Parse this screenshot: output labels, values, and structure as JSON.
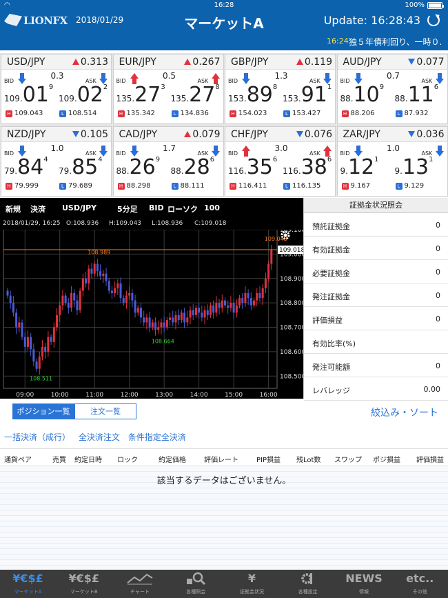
{
  "status": {
    "time": "16:28",
    "battery": "100%"
  },
  "header": {
    "logo": "LIONFX",
    "date": "2018/01/29",
    "title": "マーケットA",
    "update": "Update: 16:28:43"
  },
  "ticker": {
    "time": "16:24",
    "text": "独５年債利回り、一時０."
  },
  "labels": {
    "bid": "BID",
    "ask": "ASK",
    "high": "H",
    "low": "L"
  },
  "rates": [
    {
      "pair": "USD/JPY",
      "dir": "up",
      "change": "0.313",
      "spread": "0.3",
      "bid_arrow": "down",
      "ask_arrow": "down",
      "bid_pre": "109.",
      "bid_big": "01",
      "bid_pip": "9",
      "ask_pre": "109.",
      "ask_big": "02",
      "ask_pip": "2",
      "high": "109.043",
      "low": "108.514"
    },
    {
      "pair": "EUR/JPY",
      "dir": "up",
      "change": "0.267",
      "spread": "0.5",
      "bid_arrow": "up",
      "ask_arrow": "up",
      "bid_pre": "135.",
      "bid_big": "27",
      "bid_pip": "3",
      "ask_pre": "135.",
      "ask_big": "27",
      "ask_pip": "8",
      "high": "135.342",
      "low": "134.836"
    },
    {
      "pair": "GBP/JPY",
      "dir": "up",
      "change": "0.119",
      "spread": "1.3",
      "bid_arrow": "down",
      "ask_arrow": "down",
      "bid_pre": "153.",
      "bid_big": "89",
      "bid_pip": "8",
      "ask_pre": "153.",
      "ask_big": "91",
      "ask_pip": "1",
      "high": "154.023",
      "low": "153.427"
    },
    {
      "pair": "AUD/JPY",
      "dir": "down",
      "change": "0.077",
      "spread": "0.7",
      "bid_arrow": "down",
      "ask_arrow": "down",
      "bid_pre": "88.",
      "bid_big": "10",
      "bid_pip": "9",
      "ask_pre": "88.",
      "ask_big": "11",
      "ask_pip": "6",
      "high": "88.206",
      "low": "87.932"
    },
    {
      "pair": "NZD/JPY",
      "dir": "down",
      "change": "0.105",
      "spread": "1.0",
      "bid_arrow": "down",
      "ask_arrow": "down",
      "bid_pre": "79.",
      "bid_big": "84",
      "bid_pip": "4",
      "ask_pre": "79.",
      "ask_big": "85",
      "ask_pip": "4",
      "high": "79.999",
      "low": "79.689"
    },
    {
      "pair": "CAD/JPY",
      "dir": "up",
      "change": "0.079",
      "spread": "1.7",
      "bid_arrow": "down",
      "ask_arrow": "down",
      "bid_pre": "88.",
      "bid_big": "26",
      "bid_pip": "9",
      "ask_pre": "88.",
      "ask_big": "28",
      "ask_pip": "6",
      "high": "88.298",
      "low": "88.111"
    },
    {
      "pair": "CHF/JPY",
      "dir": "down",
      "change": "0.076",
      "spread": "3.0",
      "bid_arrow": "up",
      "ask_arrow": "up",
      "bid_pre": "116.",
      "bid_big": "35",
      "bid_pip": "6",
      "ask_pre": "116.",
      "ask_big": "38",
      "ask_pip": "6",
      "high": "116.411",
      "low": "116.135"
    },
    {
      "pair": "ZAR/JPY",
      "dir": "down",
      "change": "0.036",
      "spread": "1.0",
      "bid_arrow": "down",
      "ask_arrow": "down",
      "bid_pre": "9.",
      "bid_big": "12",
      "bid_pip": "1",
      "ask_pre": "9.",
      "ask_big": "13",
      "ask_pip": "1",
      "high": "9.167",
      "low": "9.129"
    }
  ],
  "chart_toolbar": {
    "new": "新規",
    "settle": "決済",
    "pair": "USD/JPY",
    "timeframe": "5分足",
    "side": "BID",
    "style": "ローソク",
    "count": "100"
  },
  "chart_info": {
    "datetime": "2018/01/29, 16:25",
    "open": "O:108.936",
    "high": "H:109.043",
    "low": "L:108.936",
    "close": "C:109.018"
  },
  "chart_data": {
    "type": "candlestick",
    "y_ticks": [
      "109.100",
      "109.000",
      "108.900",
      "108.800",
      "108.700",
      "108.600",
      "108.500"
    ],
    "ylim": [
      108.45,
      109.1
    ],
    "x_ticks": [
      "09:00",
      "10:00",
      "11:00",
      "12:00",
      "13:00",
      "14:00",
      "15:00",
      "16:00"
    ],
    "current_price": "109.018",
    "annotations": [
      {
        "label": "109.043",
        "index": 91,
        "value": 109.043,
        "color": "#ff7a1a"
      },
      {
        "label": "108.989",
        "index": 30,
        "value": 108.989,
        "color": "#ff7a1a"
      },
      {
        "label": "108.664",
        "index": 52,
        "value": 108.664,
        "color": "#35d135"
      },
      {
        "label": "108.511",
        "index": 10,
        "value": 108.511,
        "color": "#35d135"
      }
    ],
    "closes": [
      108.83,
      108.8,
      108.76,
      108.7,
      108.72,
      108.66,
      108.62,
      108.66,
      108.61,
      108.56,
      108.53,
      108.58,
      108.62,
      108.6,
      108.66,
      108.64,
      108.7,
      108.75,
      108.79,
      108.83,
      108.8,
      108.78,
      108.84,
      108.81,
      108.77,
      108.85,
      108.9,
      108.88,
      108.94,
      108.92,
      108.96,
      108.93,
      108.91,
      108.92,
      108.89,
      108.85,
      108.84,
      108.86,
      108.88,
      108.82,
      108.8,
      108.83,
      108.84,
      108.81,
      108.76,
      108.78,
      108.74,
      108.72,
      108.74,
      108.7,
      108.72,
      108.69,
      108.7,
      108.72,
      108.7,
      108.73,
      108.74,
      108.72,
      108.75,
      108.73,
      108.76,
      108.72,
      108.74,
      108.77,
      108.75,
      108.78,
      108.76,
      108.74,
      108.77,
      108.75,
      108.79,
      108.76,
      108.8,
      108.78,
      108.81,
      108.79,
      108.78,
      108.8,
      108.76,
      108.79,
      108.82,
      108.8,
      108.84,
      108.82,
      108.79,
      108.81,
      108.84,
      108.82,
      108.86,
      108.9,
      108.96,
      109.018
    ]
  },
  "margin": {
    "title": "証拠金状況照会",
    "rows": [
      {
        "label": "預託証拠金",
        "value": "0"
      },
      {
        "label": "有効証拠金",
        "value": "0"
      },
      {
        "label": "必要証拠金",
        "value": "0"
      },
      {
        "label": "発注証拠金",
        "value": "0"
      },
      {
        "label": "評価損益",
        "value": "0"
      },
      {
        "label": "有効比率(%)",
        "value": ""
      },
      {
        "label": "発注可能額",
        "value": "0"
      },
      {
        "label": "レバレッジ",
        "value": "0.00"
      }
    ]
  },
  "tabs": {
    "positions": "ポジション一覧",
    "orders": "注文一覧"
  },
  "filter": "絞込み・ソート",
  "actions": [
    "一括決済（成行）",
    "全決済注文",
    "条件指定全決済"
  ],
  "columns": [
    "通貨ペア",
    "売買",
    "約定日時",
    "ロック",
    "約定価格",
    "評価レート",
    "PIP損益",
    "残Lot数",
    "スワップ",
    "ポジ損益",
    "評価損益"
  ],
  "empty_message": "該当するデータはございません。",
  "tabbar": [
    {
      "icon": "¥€$£",
      "label": "マーケットA"
    },
    {
      "icon": "¥€$£",
      "label": "マーケットB"
    },
    {
      "icon": "chart-icon",
      "label": "チャート"
    },
    {
      "icon": "search-icon",
      "label": "各種照会"
    },
    {
      "icon": "¥",
      "label": "証拠金状況"
    },
    {
      "icon": "gear-icon",
      "label": "各種設定"
    },
    {
      "icon": "NEWS",
      "label": "情報"
    },
    {
      "icon": "etc..",
      "label": "その他"
    }
  ],
  "colors": {
    "brand": "#0d62ad",
    "up": "#e0313c",
    "down": "#2a6fd6",
    "accent": "#2a74d6"
  }
}
